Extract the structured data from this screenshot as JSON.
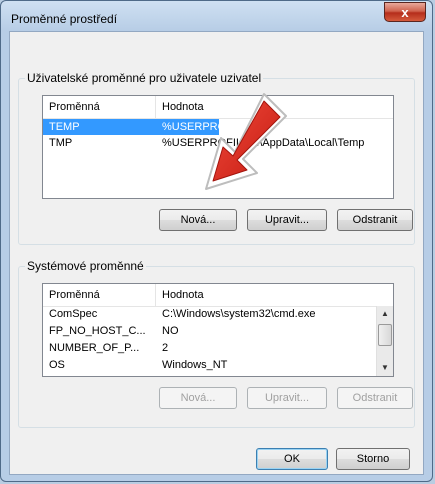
{
  "window": {
    "title": "Proměnné prostředí",
    "close_label": "x"
  },
  "user_section": {
    "label": "Uživatelské proměnné pro uživatele uzivatel",
    "columns": [
      "Proměnná",
      "Hodnota"
    ],
    "rows": [
      {
        "name": "TEMP",
        "value": "%USERPROFILE%\\AppData\\Local\\Temp",
        "selected": true
      },
      {
        "name": "TMP",
        "value": "%USERPROFILE%\\AppData\\Local\\Temp",
        "selected": false
      }
    ],
    "buttons": {
      "new": "Nová...",
      "edit": "Upravit...",
      "delete": "Odstranit"
    }
  },
  "system_section": {
    "label": "Systémové proměnné",
    "columns": [
      "Proměnná",
      "Hodnota"
    ],
    "rows": [
      {
        "name": "ComSpec",
        "value": "C:\\Windows\\system32\\cmd.exe"
      },
      {
        "name": "FP_NO_HOST_C...",
        "value": "NO"
      },
      {
        "name": "NUMBER_OF_P...",
        "value": "2"
      },
      {
        "name": "OS",
        "value": "Windows_NT"
      }
    ],
    "buttons": {
      "new": "Nová...",
      "edit": "Upravit...",
      "delete": "Odstranit"
    }
  },
  "footer": {
    "ok": "OK",
    "cancel": "Storno"
  },
  "colors": {
    "selection": "#3399ff",
    "arrow": "#e8251f",
    "close": "#c7402b"
  }
}
